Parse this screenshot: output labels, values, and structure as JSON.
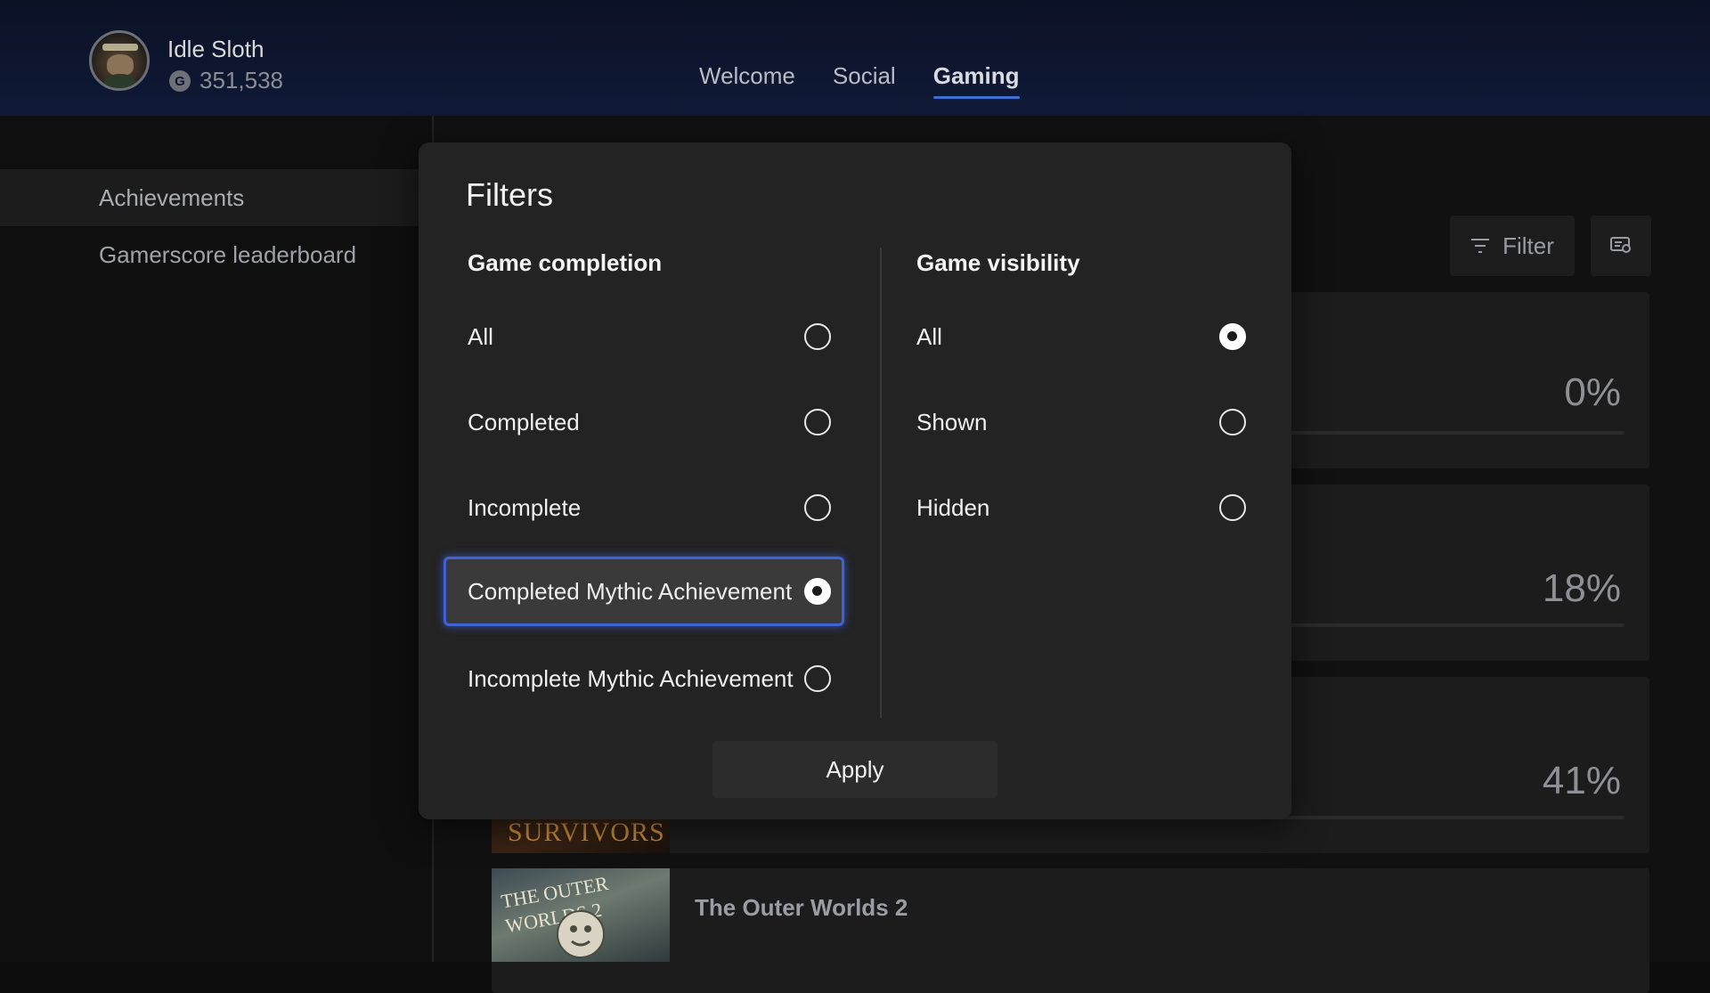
{
  "header": {
    "username": "Idle Sloth",
    "gamerscore_icon": "G",
    "gamerscore": "351,538",
    "tabs": [
      {
        "label": "Welcome",
        "active": false
      },
      {
        "label": "Social",
        "active": false
      },
      {
        "label": "Gaming",
        "active": true
      }
    ]
  },
  "sidebar": {
    "items": [
      {
        "label": "Achievements",
        "selected": true
      },
      {
        "label": "Gamerscore leaderboard",
        "selected": false
      }
    ]
  },
  "toolbar": {
    "filter_label": "Filter",
    "filter_icon": "filter-icon",
    "view_icon": "view-options-icon"
  },
  "games": [
    {
      "percent": "0%"
    },
    {
      "percent": "18%"
    },
    {
      "percent": "41%",
      "cover_text": "SURVIVORS"
    },
    {
      "title": "The Outer Worlds 2",
      "cover_text": "THE OUTER WORLDS 2"
    }
  ],
  "filters": {
    "title": "Filters",
    "completion": {
      "heading": "Game completion",
      "options": [
        {
          "label": "All",
          "selected": false
        },
        {
          "label": "Completed",
          "selected": false
        },
        {
          "label": "Incomplete",
          "selected": false
        },
        {
          "label": "Completed Mythic Achievement",
          "selected": true,
          "focused": true
        },
        {
          "label": "Incomplete Mythic Achievement",
          "selected": false
        }
      ]
    },
    "visibility": {
      "heading": "Game visibility",
      "options": [
        {
          "label": "All",
          "selected": true
        },
        {
          "label": "Shown",
          "selected": false
        },
        {
          "label": "Hidden",
          "selected": false
        }
      ]
    },
    "apply_label": "Apply"
  },
  "colors": {
    "accent": "#3f62d6",
    "modal_bg": "#232323",
    "header_bg": "#0e1630"
  }
}
